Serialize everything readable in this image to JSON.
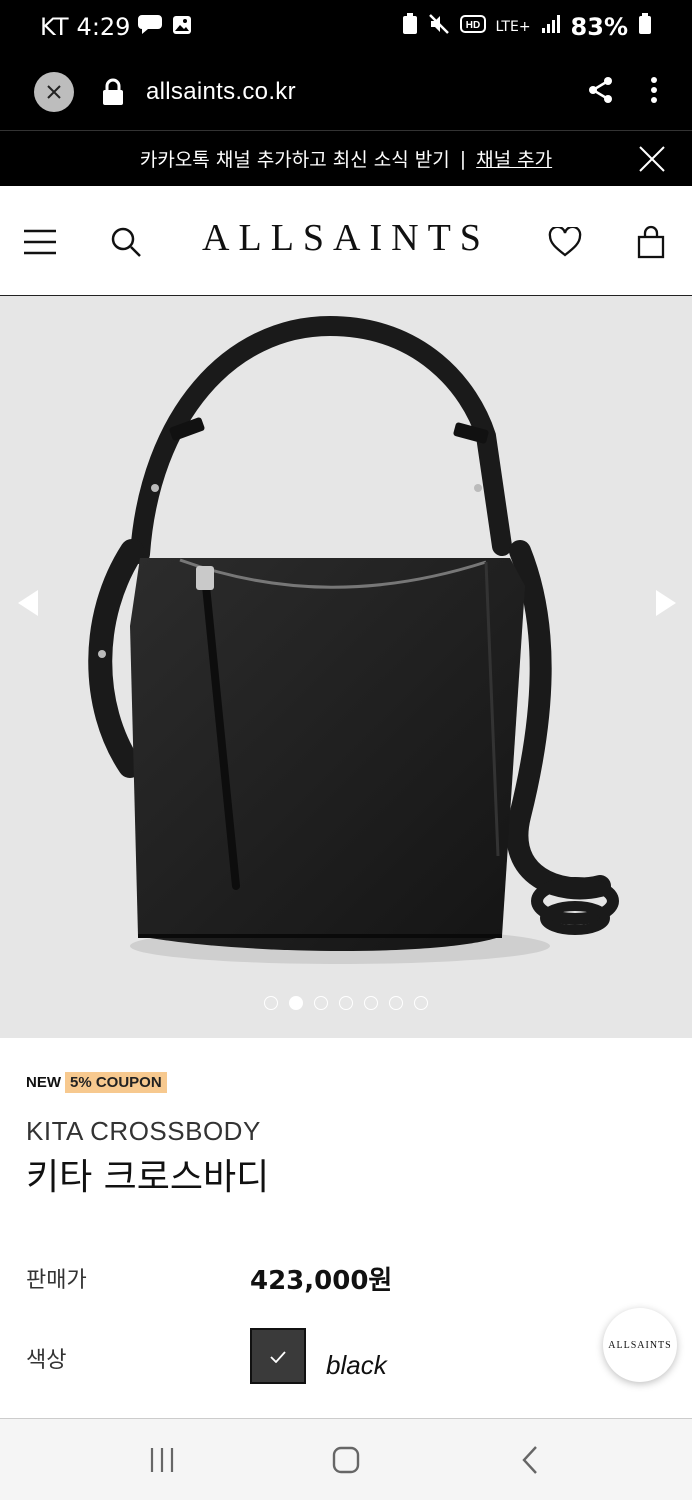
{
  "status_bar": {
    "carrier": "KT",
    "time": "4:29",
    "network": "LTE+",
    "battery": "83%",
    "icons": [
      "chat-bubble-icon",
      "image-icon",
      "battery-saver-icon",
      "mute-icon",
      "hd-icon",
      "signal-icon",
      "battery-icon"
    ]
  },
  "browser": {
    "url": "allsaints.co.kr",
    "icons": [
      "close-icon",
      "lock-icon",
      "share-icon",
      "more-icon"
    ]
  },
  "banner": {
    "text": "카카오톡 채널 추가하고 최신 소식 받기",
    "separator": "|",
    "link": "채널 추가"
  },
  "header": {
    "logo": "ALLSAINTS",
    "icons": [
      "menu-icon",
      "search-icon",
      "heart-icon",
      "bag-icon"
    ]
  },
  "gallery": {
    "dot_count": 7,
    "active_index": 1,
    "icons": [
      "arrow-left-icon",
      "arrow-right-icon"
    ]
  },
  "product": {
    "badge_new": "NEW",
    "badge_coupon": "5% COUPON",
    "name_en": "KITA CROSSBODY",
    "name_ko": "키타 크로스바디",
    "price_label": "판매가",
    "price": "423,000원",
    "color_label": "색상",
    "color_name": "black",
    "color_swatch": "#3a3a3a"
  },
  "fab": {
    "label": "ALLSAINTS"
  },
  "nav": {
    "icons": [
      "recent-apps-icon",
      "home-icon",
      "back-icon"
    ]
  }
}
